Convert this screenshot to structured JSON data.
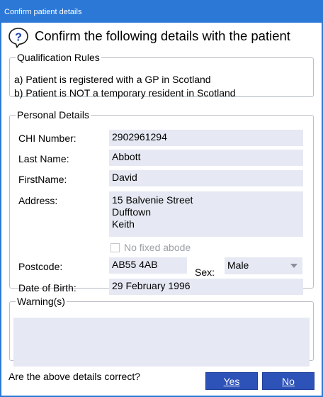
{
  "window": {
    "title": "Confirm patient details"
  },
  "header": {
    "icon": "question-help-icon",
    "text": "Confirm the following details with the patient"
  },
  "qualification": {
    "legend": "Qualification Rules",
    "rules": [
      "a) Patient is registered with a GP in Scotland",
      "b) Patient is NOT a temporary resident in Scotland"
    ]
  },
  "personal": {
    "legend": "Personal Details",
    "chi_label": "CHI Number:",
    "chi_value": "2902961294",
    "last_name_label": "Last Name:",
    "last_name_value": "Abbott",
    "first_name_label": "FirstName:",
    "first_name_value": "David",
    "address_label": "Address:",
    "address_lines": [
      "15 Balvenie Street",
      "Dufftown",
      "Keith"
    ],
    "no_fixed_abode_label": "No fixed abode",
    "no_fixed_abode_checked": false,
    "postcode_label": "Postcode:",
    "postcode_value": "AB55 4AB",
    "sex_label": "Sex:",
    "sex_value": "Male",
    "dob_label": "Date of Birth:",
    "dob_value": "29 February 1996"
  },
  "warnings": {
    "legend": "Warning(s)",
    "text": ""
  },
  "footer": {
    "question": "Are the above details correct?",
    "yes_label": "Yes",
    "no_label": "No"
  },
  "colors": {
    "titlebar": "#2b78d6",
    "field_bg": "#e6e9f3",
    "button_bg": "#2d52b8",
    "group_border": "#b9bfc8"
  }
}
